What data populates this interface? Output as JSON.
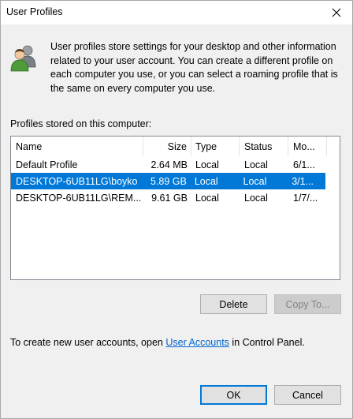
{
  "window": {
    "title": "User Profiles"
  },
  "intro": {
    "icon": "user-profiles-icon",
    "text": "User profiles store settings for your desktop and other information related to your user account. You can create a different profile on each computer you use, or you can select a roaming profile that is the same on every computer you use."
  },
  "profiles": {
    "label": "Profiles stored on this computer:",
    "columns": {
      "name": "Name",
      "size": "Size",
      "type": "Type",
      "status": "Status",
      "modified": "Mo..."
    },
    "rows": [
      {
        "name": "Default Profile",
        "size": "2.64 MB",
        "type": "Local",
        "status": "Local",
        "modified": "6/1...",
        "selected": false
      },
      {
        "name": "DESKTOP-6UB11LG\\boyko",
        "size": "5.89 GB",
        "type": "Local",
        "status": "Local",
        "modified": "3/1...",
        "selected": true
      },
      {
        "name": "DESKTOP-6UB11LG\\REM...",
        "size": "9.61 GB",
        "type": "Local",
        "status": "Local",
        "modified": "1/7/...",
        "selected": false
      }
    ]
  },
  "buttons": {
    "delete": "Delete",
    "copy_to": "Copy To...",
    "ok": "OK",
    "cancel": "Cancel"
  },
  "footer": {
    "prefix": "To create new user accounts, open ",
    "link": "User Accounts",
    "suffix": " in Control Panel."
  },
  "colors": {
    "selection": "#0078d7",
    "link": "#0066cc",
    "dialog_bg": "#f0f0f0"
  }
}
